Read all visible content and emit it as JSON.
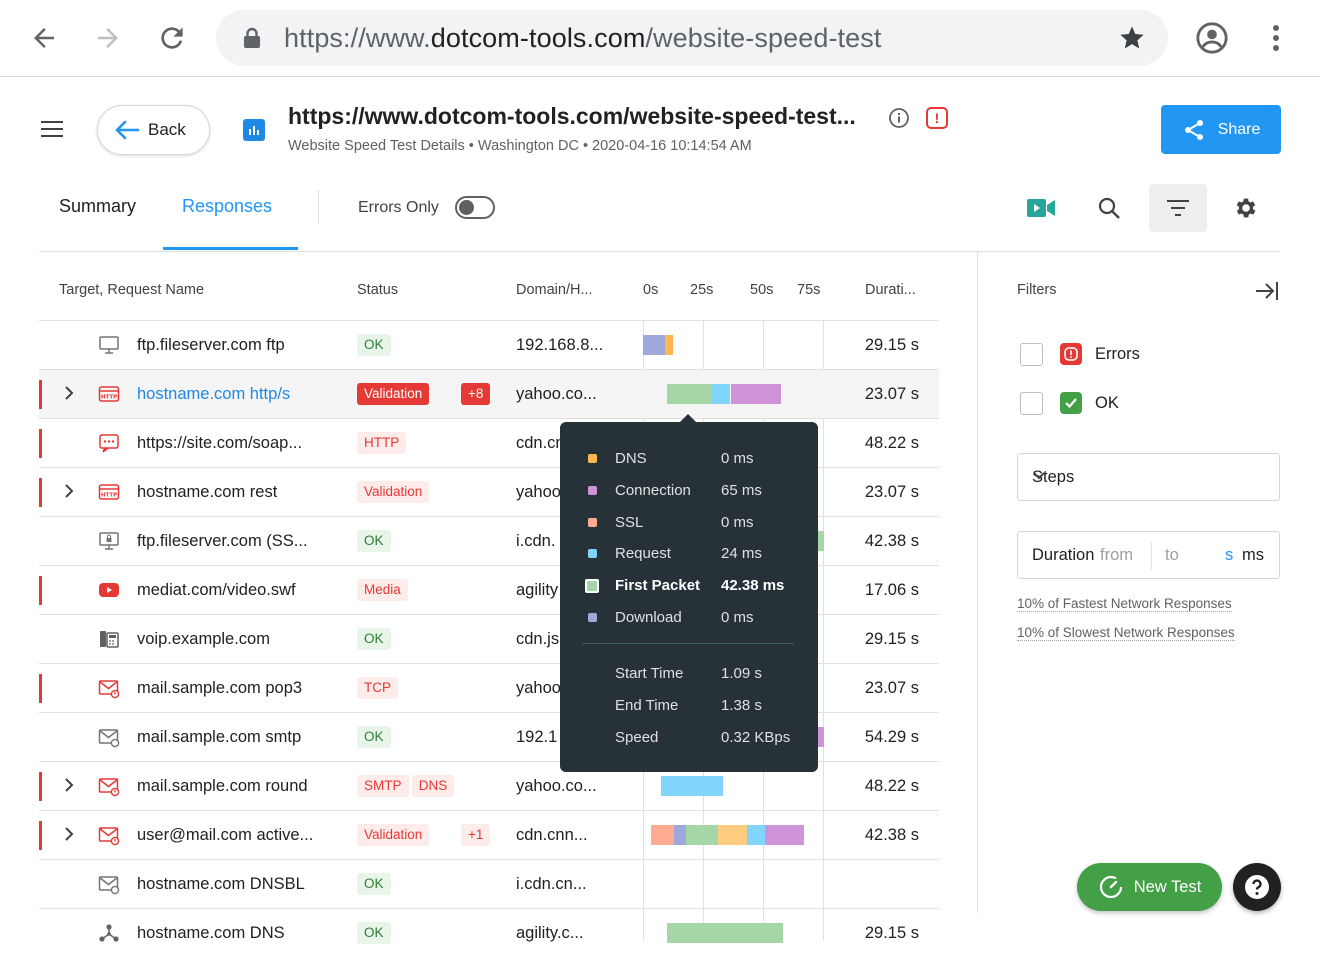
{
  "browser": {
    "url_prefix": "https://www.",
    "url_domain": "dotcom-tools.com",
    "url_path": "/website-speed-test"
  },
  "header": {
    "back_label": "Back",
    "title": "https://www.dotcom-tools.com/website-speed-test...",
    "subtitle": "Website Speed Test Details  •  Washington DC  •  2020-04-16 10:14:54 AM",
    "error_badge": "!",
    "share_label": "Share"
  },
  "tabs": {
    "summary": "Summary",
    "responses": "Responses",
    "errors_only": "Errors Only"
  },
  "table": {
    "headers": {
      "target": "Target, Request Name",
      "status": "Status",
      "domain": "Domain/H...",
      "t0": "0s",
      "t25": "25s",
      "t50": "50s",
      "t75": "75s",
      "duration": "Durati..."
    },
    "rows": [
      {
        "flag": false,
        "expand": false,
        "icon": "monitor-icon",
        "name": "ftp.fileserver.com ftp",
        "link": false,
        "badges": [
          {
            "text": "OK",
            "kind": "ok"
          }
        ],
        "domain": "192.168.8...",
        "duration": "29.15 s"
      },
      {
        "flag": true,
        "expand": true,
        "icon": "http-icon",
        "name": "hostname.com http/s",
        "link": true,
        "badges": [
          {
            "text": "Validation",
            "kind": "solid"
          },
          {
            "text": "+8",
            "kind": "solid"
          }
        ],
        "domain": "yahoo.co...",
        "duration": "23.07 s"
      },
      {
        "flag": true,
        "expand": false,
        "icon": "soap-icon",
        "name": "https://site.com/soap...",
        "link": false,
        "badges": [
          {
            "text": "HTTP",
            "kind": "err"
          }
        ],
        "domain": "cdn.cn",
        "duration": "48.22 s"
      },
      {
        "flag": true,
        "expand": true,
        "icon": "http-icon",
        "name": "hostname.com rest",
        "link": false,
        "badges": [
          {
            "text": "Validation",
            "kind": "err"
          }
        ],
        "domain": "yahoo",
        "duration": "23.07 s"
      },
      {
        "flag": false,
        "expand": false,
        "icon": "secure-monitor-icon",
        "name": "ftp.fileserver.com (SS...",
        "link": false,
        "badges": [
          {
            "text": "OK",
            "kind": "ok"
          }
        ],
        "domain": "i.cdn.",
        "duration": "42.38 s"
      },
      {
        "flag": true,
        "expand": false,
        "icon": "video-icon",
        "name": "mediat.com/video.swf",
        "link": false,
        "badges": [
          {
            "text": "Media",
            "kind": "err"
          }
        ],
        "domain": "agility",
        "duration": "17.06 s"
      },
      {
        "flag": false,
        "expand": false,
        "icon": "phone-icon",
        "name": "voip.example.com",
        "link": false,
        "badges": [
          {
            "text": "OK",
            "kind": "ok"
          }
        ],
        "domain": "cdn.js",
        "duration": "29.15 s"
      },
      {
        "flag": true,
        "expand": false,
        "icon": "mail-error-icon",
        "name": "mail.sample.com pop3",
        "link": false,
        "badges": [
          {
            "text": "TCP",
            "kind": "err"
          }
        ],
        "domain": "yahoo",
        "duration": "23.07 s"
      },
      {
        "flag": false,
        "expand": false,
        "icon": "mail-icon",
        "name": "mail.sample.com smtp",
        "link": false,
        "badges": [
          {
            "text": "OK",
            "kind": "ok"
          }
        ],
        "domain": "192.1",
        "duration": "54.29 s"
      },
      {
        "flag": true,
        "expand": true,
        "icon": "mail-error-icon",
        "name": "mail.sample.com round",
        "link": false,
        "badges": [
          {
            "text": "SMTP",
            "kind": "err"
          },
          {
            "text": "DNS",
            "kind": "err"
          }
        ],
        "domain": "yahoo.co...",
        "duration": "48.22 s"
      },
      {
        "flag": true,
        "expand": true,
        "icon": "mail-error-icon",
        "name": "user@mail.com active...",
        "link": false,
        "badges": [
          {
            "text": "Validation",
            "kind": "err"
          },
          {
            "text": "+1",
            "kind": "err"
          }
        ],
        "domain": "cdn.cnn...",
        "duration": "42.38 s"
      },
      {
        "flag": false,
        "expand": false,
        "icon": "mail-icon",
        "name": "hostname.com DNSBL",
        "link": false,
        "badges": [
          {
            "text": "OK",
            "kind": "ok"
          }
        ],
        "domain": "i.cdn.cn...",
        "duration": ""
      },
      {
        "flag": false,
        "expand": false,
        "icon": "network-icon",
        "name": "hostname.com DNS",
        "link": false,
        "badges": [
          {
            "text": "OK",
            "kind": "ok"
          }
        ],
        "domain": "agility.c...",
        "duration": "29.15 s"
      }
    ]
  },
  "tooltip": {
    "phases": [
      {
        "label": "DNS",
        "value": "0 ms",
        "color": "#ffb74d",
        "bold": false
      },
      {
        "label": "Connection",
        "value": "65 ms",
        "color": "#ce93d8",
        "bold": false
      },
      {
        "label": "SSL",
        "value": "0 ms",
        "color": "#ffab91",
        "bold": false
      },
      {
        "label": "Request",
        "value": "24 ms",
        "color": "#81d4fa",
        "bold": false
      },
      {
        "label": "First Packet",
        "value": "42.38 ms",
        "color": "#a5d6a7",
        "bold": true
      },
      {
        "label": "Download",
        "value": "0 ms",
        "color": "#9fa8da",
        "bold": false
      }
    ],
    "stats": [
      {
        "label": "Start Time",
        "value": "1.09 s"
      },
      {
        "label": "End Time",
        "value": "1.38 s"
      },
      {
        "label": "Speed",
        "value": "0.32 KBps"
      }
    ]
  },
  "filters": {
    "title": "Filters",
    "errors": "Errors",
    "ok": "OK",
    "steps": "Steps",
    "duration": "Duration",
    "from": "from",
    "to": "to",
    "s": "s",
    "ms": "ms",
    "fastest": "10% of Fastest Network Responses",
    "slowest": "10% of Slowest Network Responses"
  },
  "actions": {
    "new_test": "New Test"
  },
  "colors": {
    "accent": "#2196f3",
    "error": "#e53935",
    "ok": "#43a047"
  }
}
